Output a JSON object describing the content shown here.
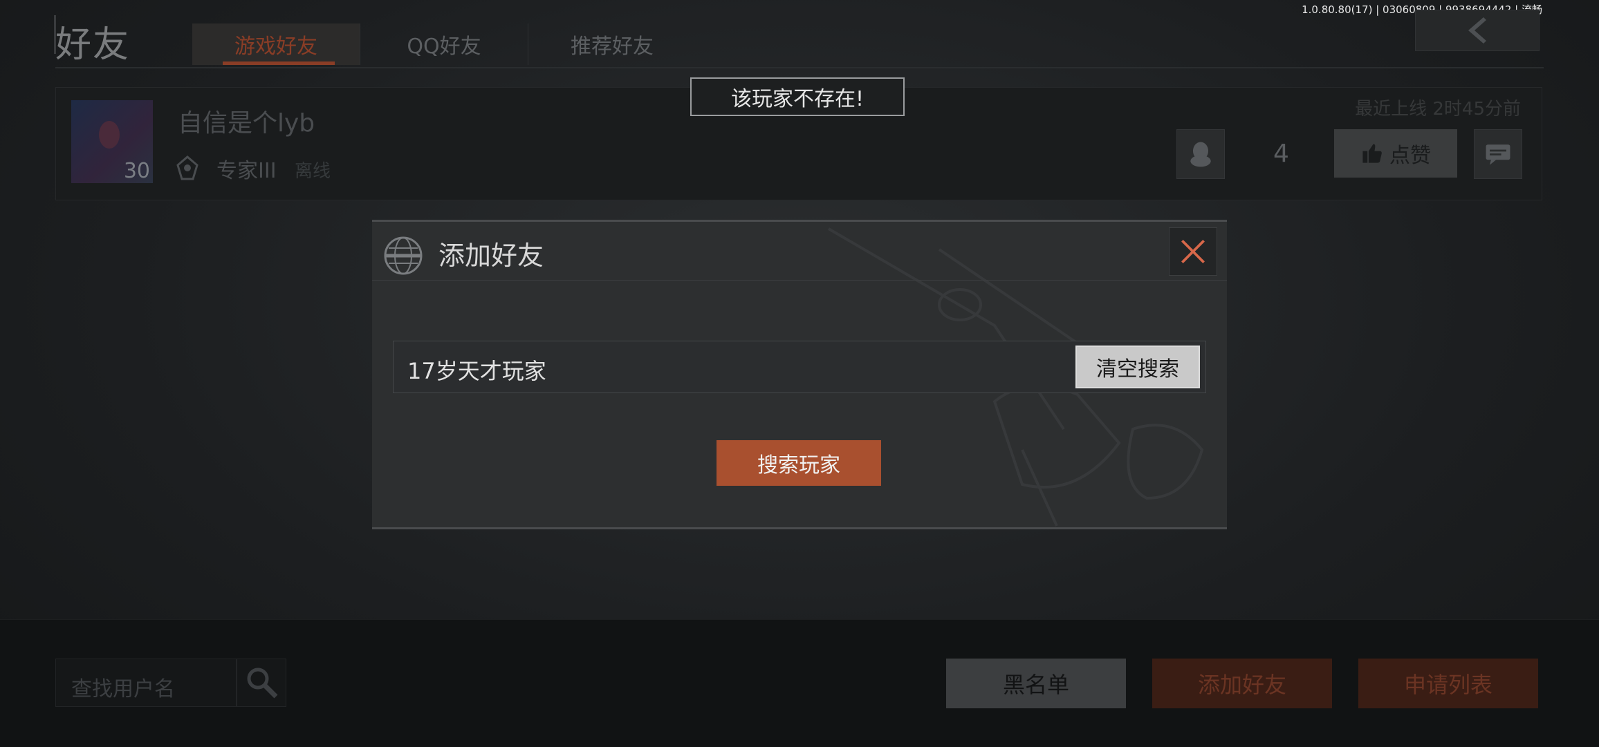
{
  "header": {
    "title": "好友",
    "tabs": [
      {
        "label": "游戏好友",
        "active": true
      },
      {
        "label": "QQ好友",
        "active": false
      },
      {
        "label": "推荐好友",
        "active": false
      }
    ],
    "version_info": "1.0.80.80(17) | 03060809 | 9938694442 | 流畅"
  },
  "friend": {
    "name": "自信是个lyb",
    "level": "30",
    "rank": "专家III",
    "status": "离线",
    "last_online": "最近上线 2时45分前",
    "like_count": "4",
    "like_label": "点赞"
  },
  "toast": {
    "message": "该玩家不存在!"
  },
  "dialog": {
    "title": "添加好友",
    "search_value": "17岁天才玩家",
    "clear_label": "清空搜索",
    "search_label": "搜索玩家"
  },
  "bottom": {
    "search_placeholder": "查找用户名",
    "blacklist_label": "黑名单",
    "add_friend_label": "添加好友",
    "request_list_label": "申请列表"
  },
  "colors": {
    "accent": "#a9502f",
    "dim_accent": "#8a3d26",
    "close_icon": "#d9684a"
  }
}
